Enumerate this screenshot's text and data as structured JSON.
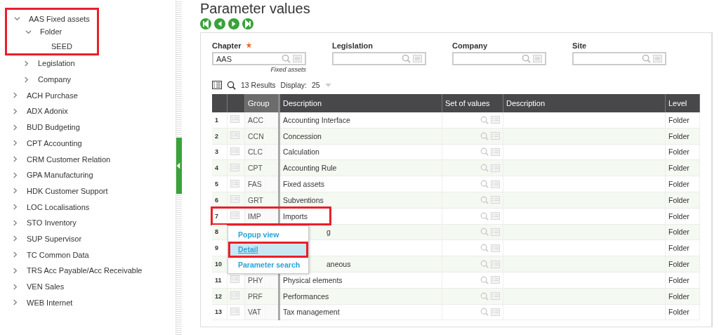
{
  "sidebar": {
    "items": [
      {
        "label": "AAS Fixed assets",
        "expanded": true,
        "highlighted": true,
        "children": [
          {
            "label": "Folder",
            "expanded": true,
            "highlighted": true,
            "children": [
              {
                "label": "SEED",
                "highlighted": true
              }
            ]
          },
          {
            "label": "Legislation",
            "expanded": false,
            "highlighted": false
          },
          {
            "label": "Company",
            "expanded": false,
            "highlighted": false
          }
        ]
      },
      {
        "label": "ACH Purchase",
        "expanded": false,
        "highlighted": false
      },
      {
        "label": "ADX Adonix",
        "expanded": false,
        "highlighted": false
      },
      {
        "label": "BUD Budgeting",
        "expanded": false,
        "highlighted": false
      },
      {
        "label": "CPT Accounting",
        "expanded": false,
        "highlighted": false
      },
      {
        "label": "CRM Customer Relation",
        "expanded": false,
        "highlighted": false
      },
      {
        "label": "GPA Manufacturing",
        "expanded": false,
        "highlighted": false
      },
      {
        "label": "HDK Customer Support",
        "expanded": false,
        "highlighted": false
      },
      {
        "label": "LOC Localisations",
        "expanded": false,
        "highlighted": false
      },
      {
        "label": "STO Inventory",
        "expanded": false,
        "highlighted": false
      },
      {
        "label": "SUP Supervisor",
        "expanded": false,
        "highlighted": false
      },
      {
        "label": "TC Common Data",
        "expanded": false,
        "highlighted": false
      },
      {
        "label": "TRS Acc Payable/Acc Receivable",
        "expanded": false,
        "highlighted": false
      },
      {
        "label": "VEN Sales",
        "expanded": false,
        "highlighted": false
      },
      {
        "label": "WEB Internet",
        "expanded": false,
        "highlighted": false
      }
    ]
  },
  "page": {
    "title": "Parameter values"
  },
  "fields": [
    {
      "label": "Chapter",
      "required": true,
      "value": "AAS",
      "hint": "Fixed assets"
    },
    {
      "label": "Legislation",
      "required": false
    },
    {
      "label": "Company",
      "required": false
    },
    {
      "label": "Site",
      "required": false
    }
  ],
  "toolbar": {
    "results": "13 Results",
    "display_label": "Display:",
    "display_value": "25"
  },
  "table": {
    "columns": [
      {
        "label": "Group",
        "kind": "group"
      },
      {
        "label": "Description",
        "kind": "desc"
      },
      {
        "label": "Set of values",
        "kind": "set"
      },
      {
        "label": "Description",
        "kind": "desc2"
      },
      {
        "label": "Level",
        "kind": "level"
      }
    ],
    "rows": [
      {
        "num": "1",
        "group": "ACC",
        "description": "Accounting Interface",
        "level": "Folder",
        "highlighted": false
      },
      {
        "num": "2",
        "group": "CCN",
        "description": "Concession",
        "level": "Folder",
        "highlighted": false
      },
      {
        "num": "3",
        "group": "CLC",
        "description": "Calculation",
        "level": "Folder",
        "highlighted": false
      },
      {
        "num": "4",
        "group": "CPT",
        "description": "Accounting Rule",
        "level": "Folder",
        "highlighted": false
      },
      {
        "num": "5",
        "group": "FAS",
        "description": "Fixed assets",
        "level": "Folder",
        "highlighted": false
      },
      {
        "num": "6",
        "group": "GRT",
        "description": "Subventions",
        "level": "Folder",
        "highlighted": false
      },
      {
        "num": "7",
        "group": "IMP",
        "description": "Imports",
        "level": "Folder",
        "highlighted": true
      },
      {
        "num": "8",
        "description": "g",
        "level": "Folder",
        "highlighted": false
      },
      {
        "num": "9",
        "level": "Folder",
        "highlighted": false
      },
      {
        "num": "10",
        "description": "aneous",
        "level": "Folder",
        "highlighted": false
      },
      {
        "num": "11",
        "group": "PHY",
        "description": "Physical elements",
        "level": "Folder",
        "highlighted": false
      },
      {
        "num": "12",
        "group": "PRF",
        "description": "Performances",
        "level": "Folder",
        "highlighted": false
      },
      {
        "num": "13",
        "group": "VAT",
        "description": "Tax management",
        "level": "Folder",
        "highlighted": false
      }
    ]
  },
  "context_menu": {
    "items": [
      {
        "label": "Popup view",
        "selected": false,
        "highlighted": false
      },
      {
        "label": "Detail",
        "selected": true,
        "highlighted": true
      },
      {
        "label": "Parameter search",
        "selected": false,
        "highlighted": false
      }
    ]
  }
}
